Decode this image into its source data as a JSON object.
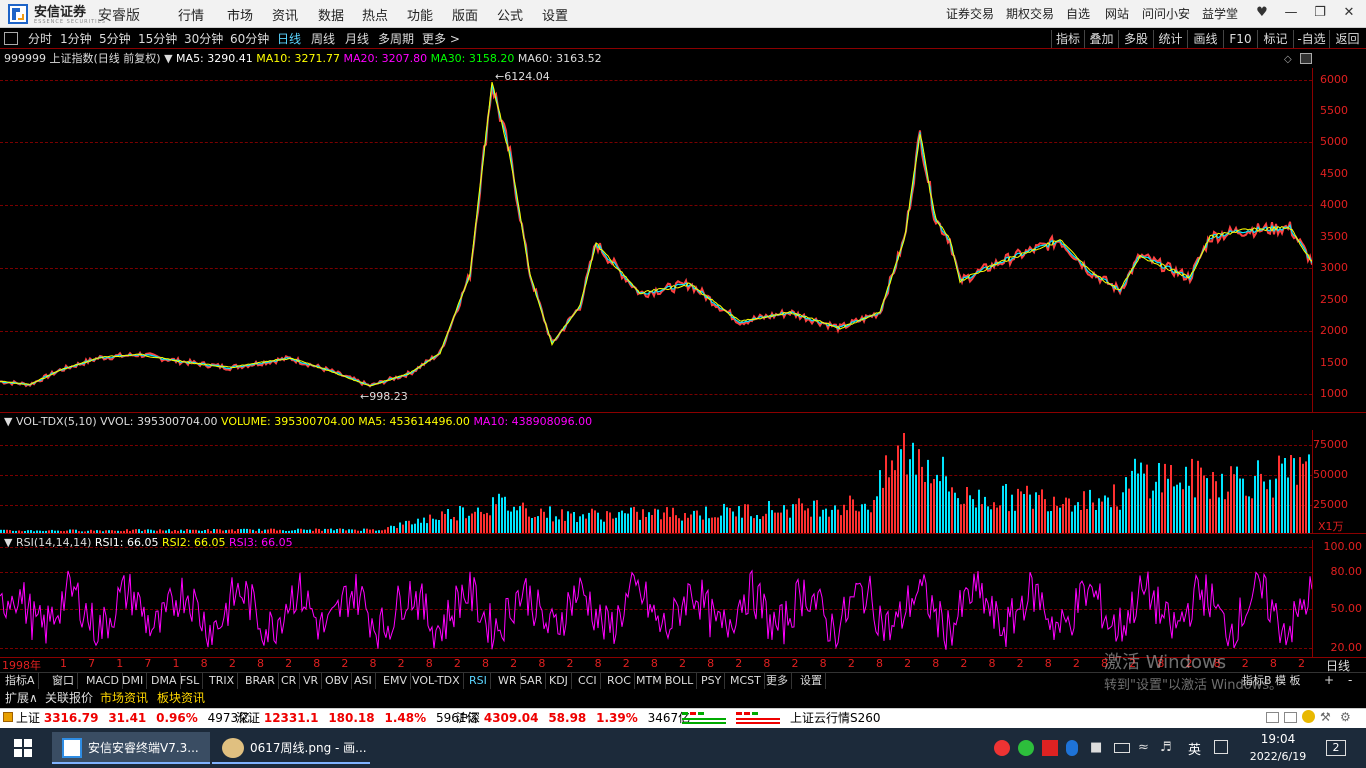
{
  "app": {
    "brand": "安信证券",
    "brand_sub": "ESSENCE SECURITIES",
    "edition": "安睿版",
    "menu": [
      "行情",
      "市场",
      "资讯",
      "数据",
      "热点",
      "功能",
      "版面",
      "公式",
      "设置"
    ],
    "right_menu": [
      "证券交易",
      "期权交易",
      "自选",
      "网站",
      "问问小安",
      "益学堂"
    ]
  },
  "periods": [
    "分时",
    "1分钟",
    "5分钟",
    "15分钟",
    "30分钟",
    "60分钟",
    "日线",
    "周线",
    "月线",
    "多周期",
    "更多 >"
  ],
  "active_period": "日线",
  "right_tools": [
    "指标",
    "叠加",
    "多股",
    "统计",
    "画线",
    "F10",
    "标记",
    "-自选",
    "返回"
  ],
  "main_chart": {
    "title": "999999 上证指数(日线 前复权)",
    "ma5": "MA5: 3290.41",
    "ma10": "MA10: 3271.77",
    "ma20": "MA20: 3207.80",
    "ma30": "MA30: 3158.20",
    "ma60": "MA60: 3163.52",
    "high_label": "6124.04",
    "low_label": "998.23",
    "y_ticks": [
      "6000",
      "5500",
      "5000",
      "4500",
      "4000",
      "3500",
      "3000",
      "2500",
      "2000",
      "1500",
      "1000"
    ]
  },
  "vol_chart": {
    "name": "VOL-TDX(5,10)",
    "vvol": "VVOL: 395300704.00",
    "volume": "VOLUME: 395300704.00",
    "ma5": "MA5: 453614496.00",
    "ma10": "MA10: 438908096.00",
    "y_ticks": [
      "75000",
      "50000",
      "25000"
    ],
    "unit": "X1万"
  },
  "rsi_chart": {
    "name": "RSI(14,14,14)",
    "rsi1": "RSI1: 66.05",
    "rsi2": "RSI2: 66.05",
    "rsi3": "RSI3: 66.05",
    "y_ticks": [
      "100.00",
      "80.00",
      "50.00",
      "20.00"
    ]
  },
  "x_axis": {
    "start_label": "1998年",
    "labels": [
      "1",
      "7",
      "1",
      "7",
      "1",
      "8",
      "2",
      "8",
      "2",
      "8",
      "2",
      "8",
      "2",
      "8",
      "2",
      "8",
      "2",
      "8",
      "2",
      "8",
      "2",
      "8",
      "2",
      "8",
      "2",
      "8",
      "2",
      "8",
      "2",
      "8",
      "2",
      "8",
      "2",
      "8",
      "2",
      "8",
      "2",
      "8",
      "2",
      "8",
      "2",
      "8",
      "2",
      "8",
      "2"
    ],
    "period_label": "日线"
  },
  "indicator_tabs": [
    "指标A",
    "窗口",
    "MACD",
    "DMI",
    "DMA",
    "FSL",
    "TRIX",
    "BRAR",
    "CR",
    "VR",
    "OBV",
    "ASI",
    "EMV",
    "VOL-TDX",
    "RSI",
    "WR",
    "SAR",
    "KDJ",
    "CCI",
    "ROC",
    "MTM",
    "BOLL",
    "PSY",
    "MCST",
    "更多",
    "设置"
  ],
  "active_indicator": "RSI",
  "bottom_right_tabs": [
    "指标B",
    "模",
    "板",
    "+",
    "-"
  ],
  "bottom_tabs": [
    "扩展∧",
    "关联报价",
    "市场资讯",
    "板块资讯"
  ],
  "watermark": {
    "line1": "激活 Windows",
    "line2": "转到\"设置\"以激活 Windows。"
  },
  "status": {
    "sh_name": "上证",
    "sh_value": "3316.79",
    "sh_change": "31.41",
    "sh_pct": "0.96%",
    "sh_amount": "4973亿",
    "sz_name": "深证",
    "sz_value": "12331.1",
    "sz_change": "180.18",
    "sz_pct": "1.48%",
    "sz_amount": "5961亿",
    "hs_name": "沪深",
    "hs_value": "4309.04",
    "hs_change": "58.98",
    "hs_pct": "1.39%",
    "hs_amount": "3467亿",
    "cloud": "上证云行情S260"
  },
  "taskbar": {
    "app1": "安信安睿终端V7.3...",
    "app2": "0617周线.png - 画...",
    "ime": "英",
    "time": "19:04",
    "date": "2022/6/19",
    "notif": "2"
  },
  "colors": {
    "up": "#ff3030",
    "down": "#00e5ff",
    "ma5": "#ffffff",
    "ma10": "#ffff00",
    "ma20": "#ff00ff",
    "ma30": "#00ff00",
    "rsi": "#ff00ff"
  }
}
